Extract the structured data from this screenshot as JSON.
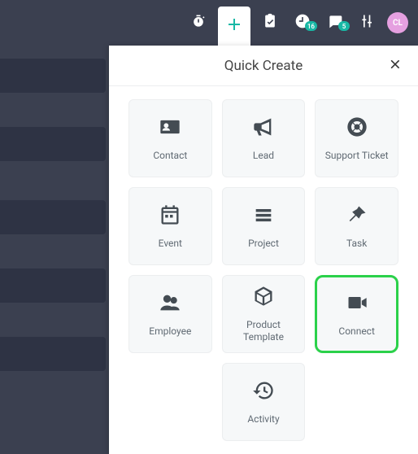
{
  "topbar": {
    "calendar_badge": "16",
    "chat_badge": "5",
    "avatar_initials": "CL"
  },
  "panel": {
    "title": "Quick Create"
  },
  "cards": {
    "contact": "Contact",
    "lead": "Lead",
    "support": "Support Ticket",
    "event": "Event",
    "project": "Project",
    "task": "Task",
    "employee": "Employee",
    "product": "Product Template",
    "connect": "Connect",
    "activity": "Activity"
  }
}
